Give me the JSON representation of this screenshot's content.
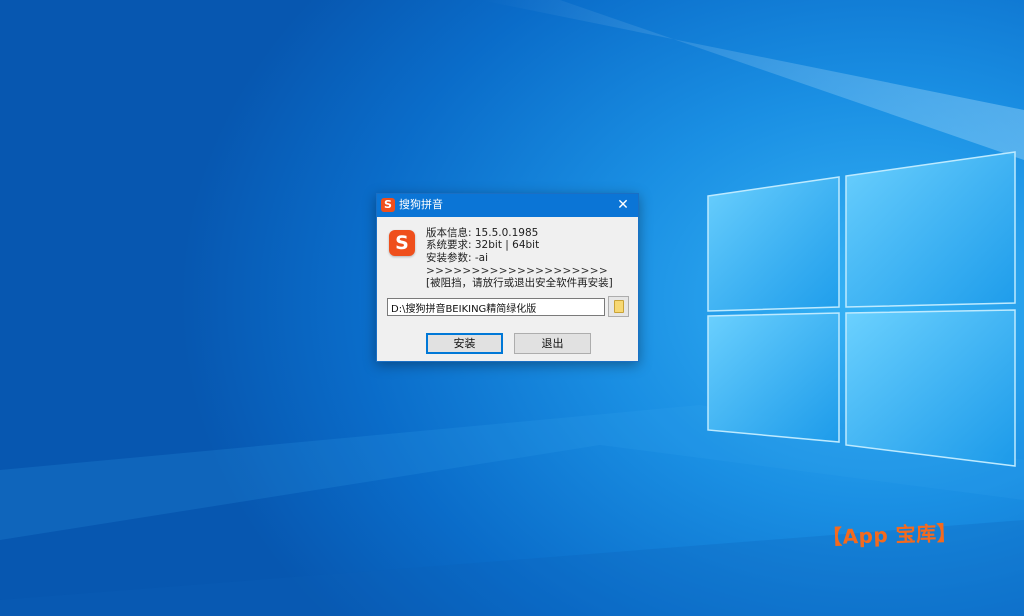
{
  "dialog": {
    "title": "搜狗拼音",
    "title_icon_letter": "S",
    "close_glyph": "✕",
    "logo_letter": "S",
    "version_line": "版本信息: 15.5.0.1985",
    "sysreq_line": "系统要求: 32bit | 64bit",
    "params_line": "安装参数: -ai",
    "arrows_line": ">>>>>>>>>>>>>>>>>>>>",
    "blocked_line": "[被阻挡，请放行或退出安全软件再安装]",
    "install_path": "D:\\搜狗拼音BEIKING精简绿化版",
    "install_label": "安装",
    "exit_label": "退出"
  },
  "watermark": "【App 宝库】",
  "colors": {
    "titlebar": "#0b75d6",
    "brand_orange": "#ef4f1c",
    "watermark": "#f46a1e",
    "desktop_blue": "#1a8fe3"
  },
  "icons": {
    "title": "sogou-logo-icon",
    "logo": "sogou-logo-icon",
    "close": "close-icon",
    "browse": "folder-icon"
  }
}
